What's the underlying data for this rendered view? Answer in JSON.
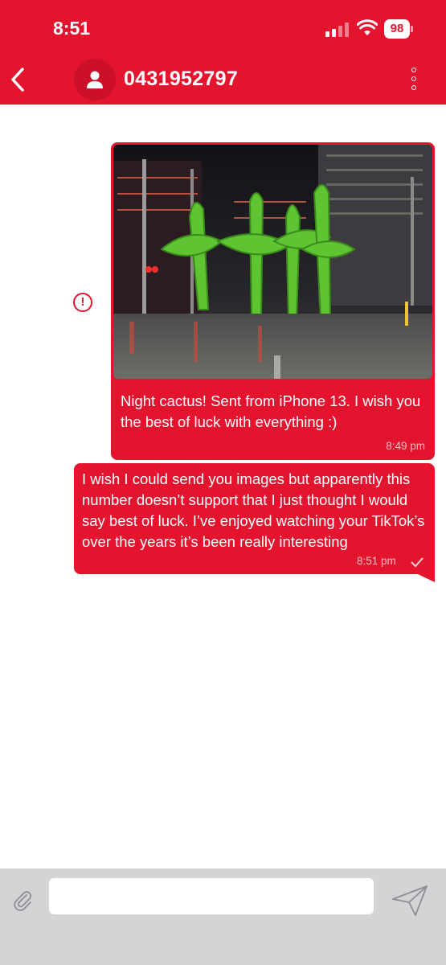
{
  "status_bar": {
    "time": "8:51",
    "battery": "98"
  },
  "header": {
    "contact": "0431952797",
    "accent_color": "#e4142f"
  },
  "messages": [
    {
      "direction": "outgoing",
      "has_image": true,
      "image_description_icon": "photo",
      "text": "Night cactus! Sent from iPhone 13. I wish you the best of luck with everything :)",
      "time": "8:49 pm",
      "status": "failed"
    },
    {
      "direction": "outgoing",
      "has_image": false,
      "text": "I wish I could send you images but apparently this number doesn’t support that I just thought I would say best of luck. I’ve enjoyed watching your TikTok’s over the years it’s been really interesting",
      "time": "8:51 pm",
      "status": "sent"
    }
  ],
  "composer": {
    "value": "",
    "placeholder": ""
  },
  "icons": {
    "back": "chevron-left-icon",
    "avatar": "person-icon",
    "menu": "kebab-menu-icon",
    "error": "exclamation-circle-icon",
    "attach": "paperclip-icon",
    "send": "paper-plane-icon",
    "check": "checkmark-icon"
  }
}
